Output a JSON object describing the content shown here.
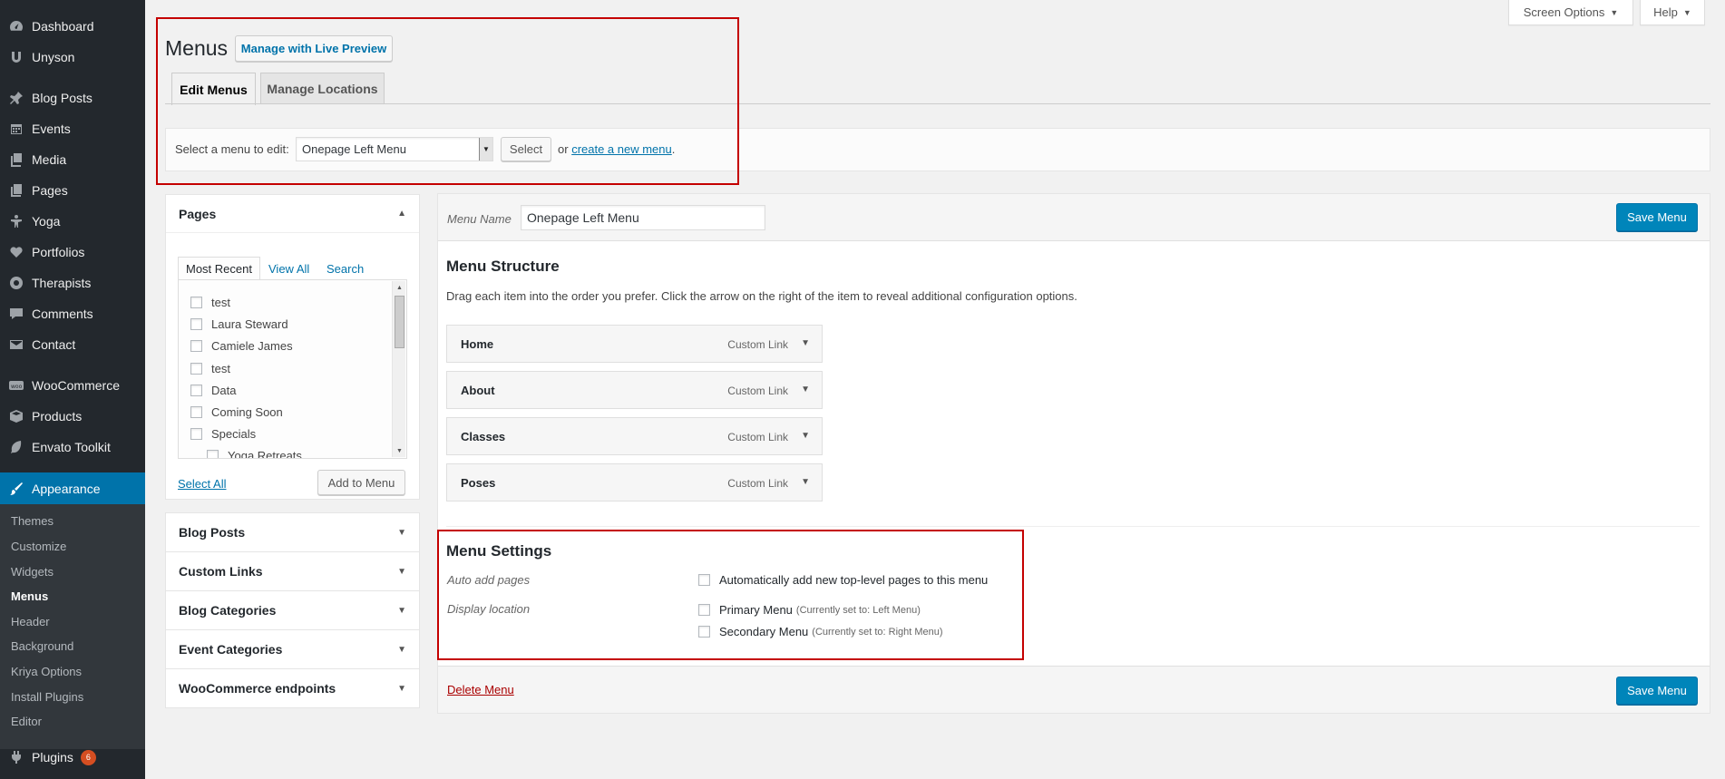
{
  "sidebar": {
    "items": [
      {
        "label": "Dashboard",
        "icon": "dashboard-icon"
      },
      {
        "label": "Unyson",
        "icon": "unyson-icon"
      },
      {
        "label": "Blog Posts",
        "icon": "pin-icon"
      },
      {
        "label": "Events",
        "icon": "calendar-icon"
      },
      {
        "label": "Media",
        "icon": "media-icon"
      },
      {
        "label": "Pages",
        "icon": "pages-icon"
      },
      {
        "label": "Yoga",
        "icon": "person-icon"
      },
      {
        "label": "Portfolios",
        "icon": "heart-icon"
      },
      {
        "label": "Therapists",
        "icon": "wheelchair-icon"
      },
      {
        "label": "Comments",
        "icon": "comment-icon"
      },
      {
        "label": "Contact",
        "icon": "envelope-icon"
      },
      {
        "label": "WooCommerce",
        "icon": "woo-icon"
      },
      {
        "label": "Products",
        "icon": "box-icon"
      },
      {
        "label": "Envato Toolkit",
        "icon": "leaf-icon"
      },
      {
        "label": "Appearance",
        "icon": "brush-icon"
      },
      {
        "label": "Plugins",
        "icon": "plug-icon",
        "badge": "6"
      }
    ],
    "appearance_submenu": [
      "Themes",
      "Customize",
      "Widgets",
      "Menus",
      "Header",
      "Background",
      "Kriya Options",
      "Install Plugins",
      "Editor"
    ],
    "current_item": "Appearance",
    "current_subitem": "Menus"
  },
  "top_tabs": {
    "screen_options": "Screen Options",
    "help": "Help"
  },
  "header": {
    "title": "Menus",
    "live_preview_button": "Manage with Live Preview",
    "tabs": [
      "Edit Menus",
      "Manage Locations"
    ],
    "active_tab": "Edit Menus"
  },
  "select_menu": {
    "label": "Select a menu to edit:",
    "selected": "Onepage Left Menu",
    "select_button": "Select",
    "or_text": "or",
    "create_link": "create a new menu",
    "period": "."
  },
  "left_panels": {
    "pages": {
      "title": "Pages",
      "tabs": [
        "Most Recent",
        "View All",
        "Search"
      ],
      "items": [
        "test",
        "Laura Steward",
        "Camiele James",
        "test",
        "Data",
        "Coming Soon",
        "Specials",
        "Yoga Retreats"
      ],
      "select_all": "Select All",
      "add_button": "Add to Menu"
    },
    "collapsed": [
      "Blog Posts",
      "Custom Links",
      "Blog Categories",
      "Event Categories",
      "WooCommerce endpoints"
    ]
  },
  "menu_edit": {
    "name_label": "Menu Name",
    "name_value": "Onepage Left Menu",
    "save_button": "Save Menu",
    "structure_title": "Menu Structure",
    "structure_help": "Drag each item into the order you prefer. Click the arrow on the right of the item to reveal additional configuration options.",
    "items": [
      {
        "title": "Home",
        "type": "Custom Link"
      },
      {
        "title": "About",
        "type": "Custom Link"
      },
      {
        "title": "Classes",
        "type": "Custom Link"
      },
      {
        "title": "Poses",
        "type": "Custom Link"
      }
    ],
    "settings": {
      "title": "Menu Settings",
      "auto_add_label": "Auto add pages",
      "auto_add_option": "Automatically add new top-level pages to this menu",
      "display_location_label": "Display location",
      "locations": [
        {
          "name": "Primary Menu",
          "hint": "(Currently set to: Left Menu)"
        },
        {
          "name": "Secondary Menu",
          "hint": "(Currently set to: Right Menu)"
        }
      ]
    },
    "delete_link": "Delete Menu"
  },
  "colors": {
    "sidebar_bg": "#23282d",
    "accent": "#0073aa",
    "primary_button": "#0085ba",
    "highlight_box": "#c40000",
    "badge": "#d54e21"
  }
}
